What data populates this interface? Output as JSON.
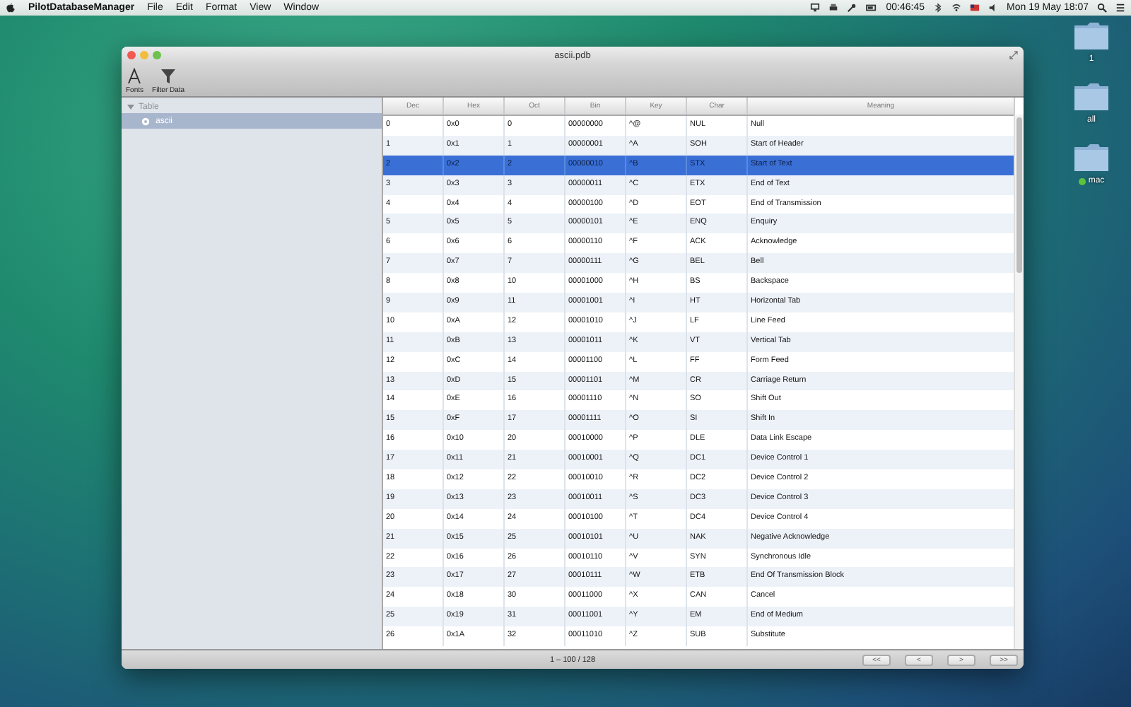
{
  "menu_bar": {
    "app_name": "PilotDatabaseManager",
    "menus": [
      "File",
      "Edit",
      "Format",
      "View",
      "Window"
    ],
    "status_time": "00:46:45",
    "clock": "Mon 19 May  18:07"
  },
  "desktop_icons": [
    {
      "label": "1"
    },
    {
      "label": "all"
    },
    {
      "label": "mac",
      "color": "#5cc43a"
    }
  ],
  "window": {
    "title": "ascii.pdb",
    "toolbar": [
      {
        "kind": "fonts",
        "label": "Fonts"
      },
      {
        "kind": "filter",
        "label": "Filter Data"
      }
    ],
    "sidebar": {
      "group": {
        "label": "Table",
        "expanded": true,
        "children": [
          {
            "label": "ascii",
            "selected": true
          }
        ]
      }
    },
    "table": {
      "columns": [
        "Dec",
        "Hex",
        "Oct",
        "Bin",
        "Key",
        "Char",
        "Meaning"
      ],
      "rows": [
        {
          "cells": [
            "0",
            "0x0",
            "0",
            "00000000",
            "^@",
            "NUL",
            "Null"
          ],
          "selected": false
        },
        {
          "cells": [
            "1",
            "0x1",
            "1",
            "00000001",
            "^A",
            "SOH",
            "Start of Header"
          ],
          "selected": false
        },
        {
          "cells": [
            "2",
            "0x2",
            "2",
            "00000010",
            "^B",
            "STX",
            "Start of Text"
          ],
          "selected": true
        },
        {
          "cells": [
            "3",
            "0x3",
            "3",
            "00000011",
            "^C",
            "ETX",
            "End of Text"
          ],
          "selected": false
        },
        {
          "cells": [
            "4",
            "0x4",
            "4",
            "00000100",
            "^D",
            "EOT",
            "End of Transmission"
          ],
          "selected": false
        },
        {
          "cells": [
            "5",
            "0x5",
            "5",
            "00000101",
            "^E",
            "ENQ",
            "Enquiry"
          ],
          "selected": false
        },
        {
          "cells": [
            "6",
            "0x6",
            "6",
            "00000110",
            "^F",
            "ACK",
            "Acknowledge"
          ],
          "selected": false
        },
        {
          "cells": [
            "7",
            "0x7",
            "7",
            "00000111",
            "^G",
            "BEL",
            "Bell"
          ],
          "selected": false
        },
        {
          "cells": [
            "8",
            "0x8",
            "10",
            "00001000",
            "^H",
            "BS",
            "Backspace"
          ],
          "selected": false
        },
        {
          "cells": [
            "9",
            "0x9",
            "11",
            "00001001",
            "^I",
            "HT",
            "Horizontal Tab"
          ],
          "selected": false
        },
        {
          "cells": [
            "10",
            "0xA",
            "12",
            "00001010",
            "^J",
            "LF",
            "Line Feed"
          ],
          "selected": false
        },
        {
          "cells": [
            "11",
            "0xB",
            "13",
            "00001011",
            "^K",
            "VT",
            "Vertical Tab"
          ],
          "selected": false
        },
        {
          "cells": [
            "12",
            "0xC",
            "14",
            "00001100",
            "^L",
            "FF",
            "Form Feed"
          ],
          "selected": false
        },
        {
          "cells": [
            "13",
            "0xD",
            "15",
            "00001101",
            "^M",
            "CR",
            "Carriage Return"
          ],
          "selected": false
        },
        {
          "cells": [
            "14",
            "0xE",
            "16",
            "00001110",
            "^N",
            "SO",
            "Shift Out"
          ],
          "selected": false
        },
        {
          "cells": [
            "15",
            "0xF",
            "17",
            "00001111",
            "^O",
            "SI",
            "Shift In"
          ],
          "selected": false
        },
        {
          "cells": [
            "16",
            "0x10",
            "20",
            "00010000",
            "^P",
            "DLE",
            "Data Link Escape"
          ],
          "selected": false
        },
        {
          "cells": [
            "17",
            "0x11",
            "21",
            "00010001",
            "^Q",
            "DC1",
            "Device Control 1"
          ],
          "selected": false
        },
        {
          "cells": [
            "18",
            "0x12",
            "22",
            "00010010",
            "^R",
            "DC2",
            "Device Control 2"
          ],
          "selected": false
        },
        {
          "cells": [
            "19",
            "0x13",
            "23",
            "00010011",
            "^S",
            "DC3",
            "Device Control 3"
          ],
          "selected": false
        },
        {
          "cells": [
            "20",
            "0x14",
            "24",
            "00010100",
            "^T",
            "DC4",
            "Device Control 4"
          ],
          "selected": false
        },
        {
          "cells": [
            "21",
            "0x15",
            "25",
            "00010101",
            "^U",
            "NAK",
            "Negative Acknowledge"
          ],
          "selected": false
        },
        {
          "cells": [
            "22",
            "0x16",
            "26",
            "00010110",
            "^V",
            "SYN",
            "Synchronous Idle"
          ],
          "selected": false
        },
        {
          "cells": [
            "23",
            "0x17",
            "27",
            "00010111",
            "^W",
            "ETB",
            "End Of Transmission Block"
          ],
          "selected": false
        },
        {
          "cells": [
            "24",
            "0x18",
            "30",
            "00011000",
            "^X",
            "CAN",
            "Cancel"
          ],
          "selected": false
        },
        {
          "cells": [
            "25",
            "0x19",
            "31",
            "00011001",
            "^Y",
            "EM",
            "End of Medium"
          ],
          "selected": false
        },
        {
          "cells": [
            "26",
            "0x1A",
            "32",
            "00011010",
            "^Z",
            "SUB",
            "Substitute"
          ],
          "selected": false
        }
      ]
    },
    "footer": {
      "range": "1 – 100 / 128",
      "pager": [
        "<<",
        "<",
        ">",
        ">>"
      ]
    }
  }
}
